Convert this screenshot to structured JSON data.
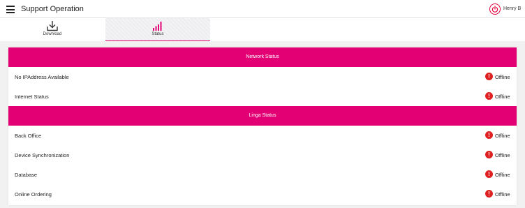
{
  "header": {
    "title": "Support Operation",
    "user_name": "Henry B",
    "menu_icon": "hamburger-icon",
    "power_icon": "power-icon"
  },
  "tabs": [
    {
      "label": "Download",
      "icon": "download-icon",
      "active": false
    },
    {
      "label": "Status",
      "icon": "signal-bars-icon",
      "active": true
    }
  ],
  "colors": {
    "accent": "#e20074",
    "error": "#e02020",
    "power": "#e4003a"
  },
  "sections": [
    {
      "title": "Network Status",
      "rows": [
        {
          "label": "No IPAddress Available",
          "status": "Offline"
        },
        {
          "label": "Internet Status",
          "status": "Offline"
        }
      ]
    },
    {
      "title": "Linga Status",
      "rows": [
        {
          "label": "Back Office",
          "status": "Offline"
        },
        {
          "label": "Device Synchronization",
          "status": "Offline"
        },
        {
          "label": "Database",
          "status": "Offline"
        },
        {
          "label": "Online Ordering",
          "status": "Offline"
        }
      ]
    }
  ]
}
